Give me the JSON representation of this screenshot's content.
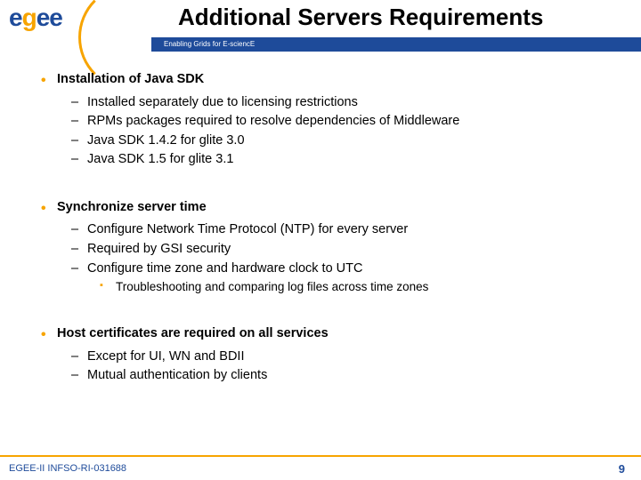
{
  "logo": {
    "e1": "e",
    "g": "g",
    "e2": "e",
    "e3": "e"
  },
  "header": {
    "title": "Additional Servers Requirements",
    "subtitle": "Enabling Grids for E-sciencE"
  },
  "bullets": [
    {
      "head": "Installation of Java SDK",
      "subs": [
        {
          "text": "Installed separately due to licensing restrictions"
        },
        {
          "text": "RPMs packages required to resolve dependencies of Middleware"
        },
        {
          "text": "Java SDK 1.4.2 for glite 3.0"
        },
        {
          "text": "Java SDK 1.5 for glite 3.1"
        }
      ]
    },
    {
      "head": "Synchronize server time",
      "subs": [
        {
          "text": "Configure Network Time Protocol (NTP) for every server"
        },
        {
          "text": "Required by GSI security"
        },
        {
          "text": "Configure time zone and hardware clock to UTC",
          "subs": [
            {
              "text": "Troubleshooting and comparing log files across time zones"
            }
          ]
        }
      ]
    },
    {
      "head": "Host certificates are required on all services",
      "subs": [
        {
          "text": "Except for UI, WN and BDII"
        },
        {
          "text": "Mutual authentication by clients"
        }
      ]
    }
  ],
  "footer": {
    "left": "EGEE-II INFSO-RI-031688",
    "right": "9"
  }
}
